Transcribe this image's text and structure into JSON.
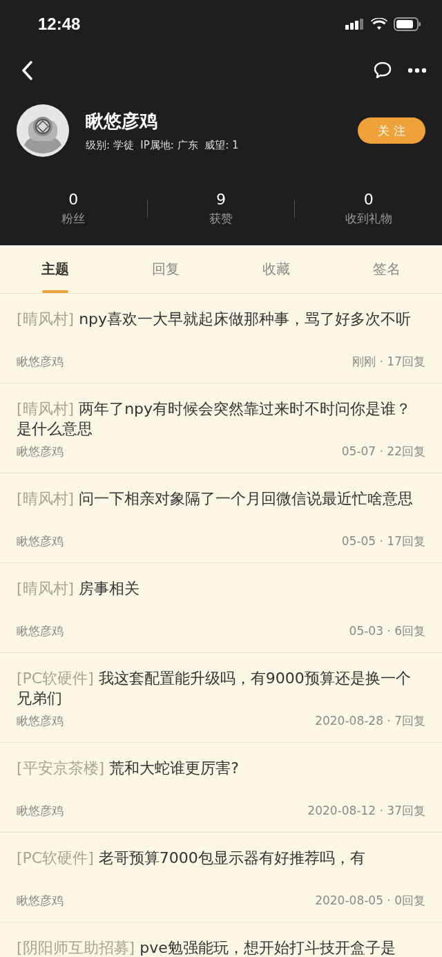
{
  "status_bar": {
    "time": "12:48"
  },
  "profile": {
    "name": "瞅悠彦鸡",
    "info": "级别: 学徒  IP属地: 广东  威望: 1",
    "follow": "关 注"
  },
  "stats": [
    {
      "value": "0",
      "label": "粉丝"
    },
    {
      "value": "9",
      "label": "获赞"
    },
    {
      "value": "0",
      "label": "收到礼物"
    }
  ],
  "tabs": [
    {
      "label": "主题",
      "selected": true
    },
    {
      "label": "回复",
      "selected": false
    },
    {
      "label": "收藏",
      "selected": false
    },
    {
      "label": "签名",
      "selected": false
    }
  ],
  "posts": [
    {
      "forum": "[晴风村]",
      "title": "npy喜欢一大早就起床做那种事，骂了好多次不听",
      "author": "瞅悠彦鸡",
      "meta": "刚刚 · 17回复"
    },
    {
      "forum": "[晴风村]",
      "title": "两年了npy有时候会突然靠过来时不时问你是谁？是什么意思",
      "author": "瞅悠彦鸡",
      "meta": "05-07 · 22回复"
    },
    {
      "forum": "[晴风村]",
      "title": "问一下相亲对象隔了一个月回微信说最近忙啥意思",
      "author": "瞅悠彦鸡",
      "meta": "05-05 · 17回复"
    },
    {
      "forum": "[晴风村]",
      "title": "房事相关",
      "author": "瞅悠彦鸡",
      "meta": "05-03 · 6回复"
    },
    {
      "forum": "[PC软硬件]",
      "title": "我这套配置能升级吗，有9000预算还是换一个兄弟们",
      "author": "瞅悠彦鸡",
      "meta": "2020-08-28 · 7回复"
    },
    {
      "forum": "[平安京茶楼]",
      "title": "荒和大蛇谁更厉害?",
      "author": "瞅悠彦鸡",
      "meta": "2020-08-12 · 37回复"
    },
    {
      "forum": "[PC软硬件]",
      "title": "老哥预算7000包显示器有好推荐吗，有",
      "author": "瞅悠彦鸡",
      "meta": "2020-08-05 · 0回复"
    },
    {
      "forum": "[阴阳师互助招募]",
      "title": "pve勉强能玩，想开始打斗技开盒子是"
    }
  ]
}
